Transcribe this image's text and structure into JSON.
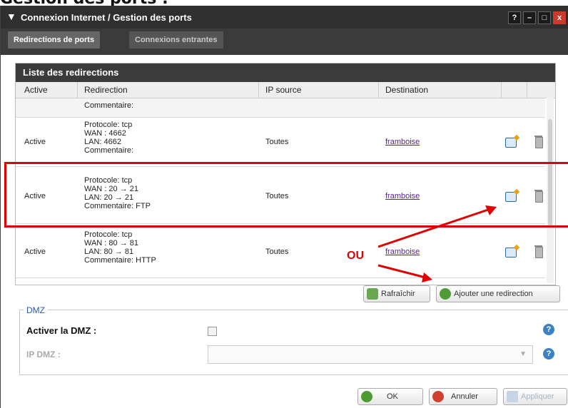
{
  "page": {
    "heading": "Gestion des ports :"
  },
  "window": {
    "title": "Connexion Internet / Gestion des ports",
    "buttons": [
      "?",
      "–",
      "□",
      "x"
    ]
  },
  "tabs": [
    {
      "label": "Redirections de ports",
      "active": true
    },
    {
      "label": "Connexions entrantes",
      "active": false
    }
  ],
  "list": {
    "title": "Liste des redirections",
    "columns": {
      "active": "Active",
      "redirection": "Redirection",
      "ip_source": "IP source",
      "destination": "Destination"
    },
    "partial_row_comment": "Commentaire:",
    "rows": [
      {
        "active": "Active",
        "protocol": "Protocole: tcp",
        "wan": "WAN : 4662",
        "lan": "LAN: 4662",
        "comment": "Commentaire:",
        "ip_source": "Toutes",
        "destination": "framboise"
      },
      {
        "active": "Active",
        "protocol": "Protocole: tcp",
        "wan": "WAN : 20 → 21",
        "lan": "LAN: 20 → 21",
        "comment": "Commentaire: FTP",
        "ip_source": "Toutes",
        "destination": "framboise"
      },
      {
        "active": "Active",
        "protocol": "Protocole: tcp",
        "wan": "WAN : 80 → 81",
        "lan": "LAN: 80 → 81",
        "comment": "Commentaire: HTTP",
        "ip_source": "Toutes",
        "destination": "framboise"
      }
    ]
  },
  "actions": {
    "refresh": "Rafraîchir",
    "add": "Ajouter une redirection"
  },
  "annotation": {
    "ou": "OU"
  },
  "dmz": {
    "legend": "DMZ",
    "enable_label": "Activer la DMZ :",
    "ip_label": "IP DMZ :",
    "help_glyph": "?"
  },
  "footer": {
    "ok": "OK",
    "cancel": "Annuler",
    "apply": "Appliquer"
  },
  "colors": {
    "title_bar": "#2f2f2f",
    "annotation_red": "#e00000",
    "link": "#5a1e8a"
  }
}
